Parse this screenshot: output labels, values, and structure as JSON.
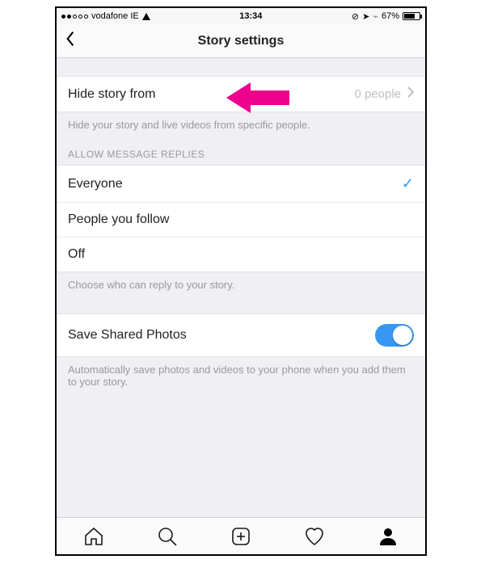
{
  "status": {
    "carrier": "vodafone IE",
    "time": "13:34",
    "battery_pct": "67%"
  },
  "nav": {
    "title": "Story settings"
  },
  "hide": {
    "label": "Hide story from",
    "value": "0 people",
    "hint": "Hide your story and live videos from specific people."
  },
  "replies": {
    "header": "ALLOW MESSAGE REPLIES",
    "options": {
      "everyone": "Everyone",
      "following": "People you follow",
      "off": "Off"
    },
    "selected": "everyone",
    "hint": "Choose who can reply to your story."
  },
  "save": {
    "label": "Save Shared Photos",
    "hint": "Automatically save photos and videos to your phone when you add them to your story."
  },
  "annotation": {
    "color": "#ec008c"
  }
}
